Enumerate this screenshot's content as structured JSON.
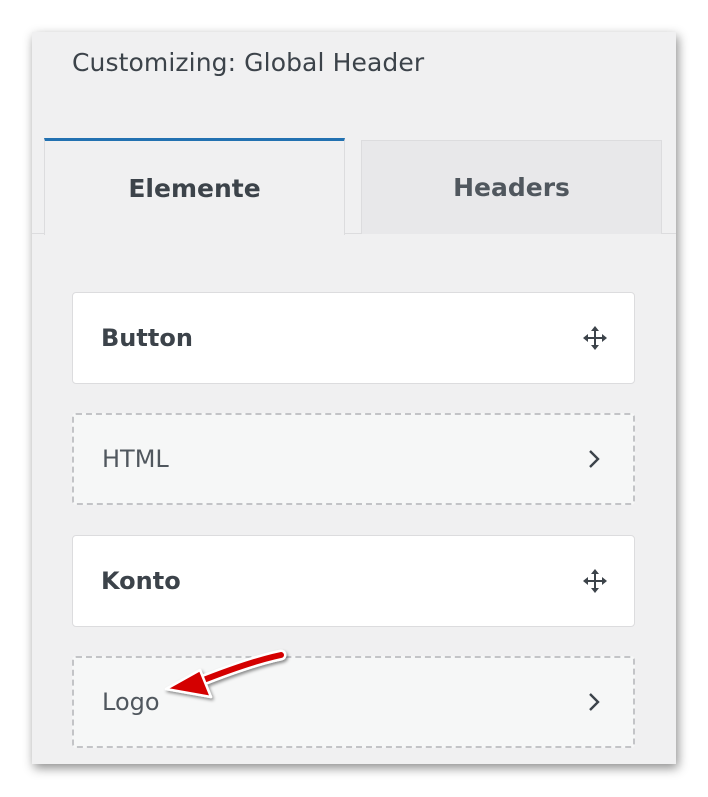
{
  "panel": {
    "title": "Customizing: Global Header"
  },
  "tabs": [
    {
      "label": "Elemente",
      "active": true
    },
    {
      "label": "Headers",
      "active": false
    }
  ],
  "items": [
    {
      "label": "Button",
      "style": "solid",
      "icon": "move-icon"
    },
    {
      "label": "HTML",
      "style": "dashed",
      "icon": "chevron-right-icon"
    },
    {
      "label": "Konto",
      "style": "solid",
      "icon": "move-icon"
    },
    {
      "label": "Logo",
      "style": "dashed",
      "icon": "chevron-right-icon"
    }
  ],
  "annotation": {
    "arrow_color": "#d40000"
  },
  "colors": {
    "accent": "#2271b1",
    "panel_bg": "#f0f0f1",
    "text": "#3c434a"
  }
}
